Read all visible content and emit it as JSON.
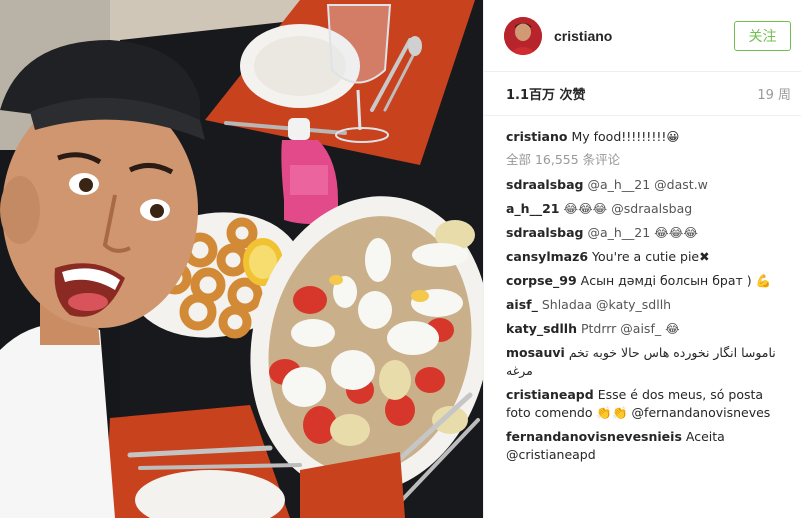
{
  "post": {
    "username": "cristiano",
    "follow_label": "关注",
    "likes": "1.1百万 次赞",
    "time": "19 周"
  },
  "caption": {
    "user": "cristiano",
    "text": "My food!!!!!!!!!😀"
  },
  "view_all_comments": "全部 16,555 条评论",
  "comments": [
    {
      "user": "sdraalsbag",
      "text": "@a_h__21 @dast.w"
    },
    {
      "user": "a_h__21",
      "text": "😂😂😂 @sdraalsbag"
    },
    {
      "user": "sdraalsbag",
      "text": "@a_h__21 😂😂😂"
    },
    {
      "user": "cansylmaz6",
      "text": "You're a cutie pie✖"
    },
    {
      "user": "corpse_99",
      "text": "Асын дәмді болсын брат ) 💪"
    },
    {
      "user": "aisf_",
      "text": "Shladaa @katy_sdllh"
    },
    {
      "user": "katy_sdllh",
      "text": "Ptdrrr @aisf_ 😂"
    },
    {
      "user": "mosauvi",
      "text": "ناموسا انگار نخورده هاس حالا خوبه تخم مرغه"
    },
    {
      "user": "cristianeapd",
      "text": "Esse é dos meus, só posta foto comendo 👏👏 @fernandanovisneves"
    },
    {
      "user": "fernandanovisnevesnieis",
      "text": "Aceita @cristianeapd"
    }
  ],
  "icons": {
    "avatar": "profile-avatar-icon"
  },
  "colors": {
    "follow_green": "#70c050",
    "placemat": "#c9421e",
    "plate": "#f4f2ee"
  }
}
